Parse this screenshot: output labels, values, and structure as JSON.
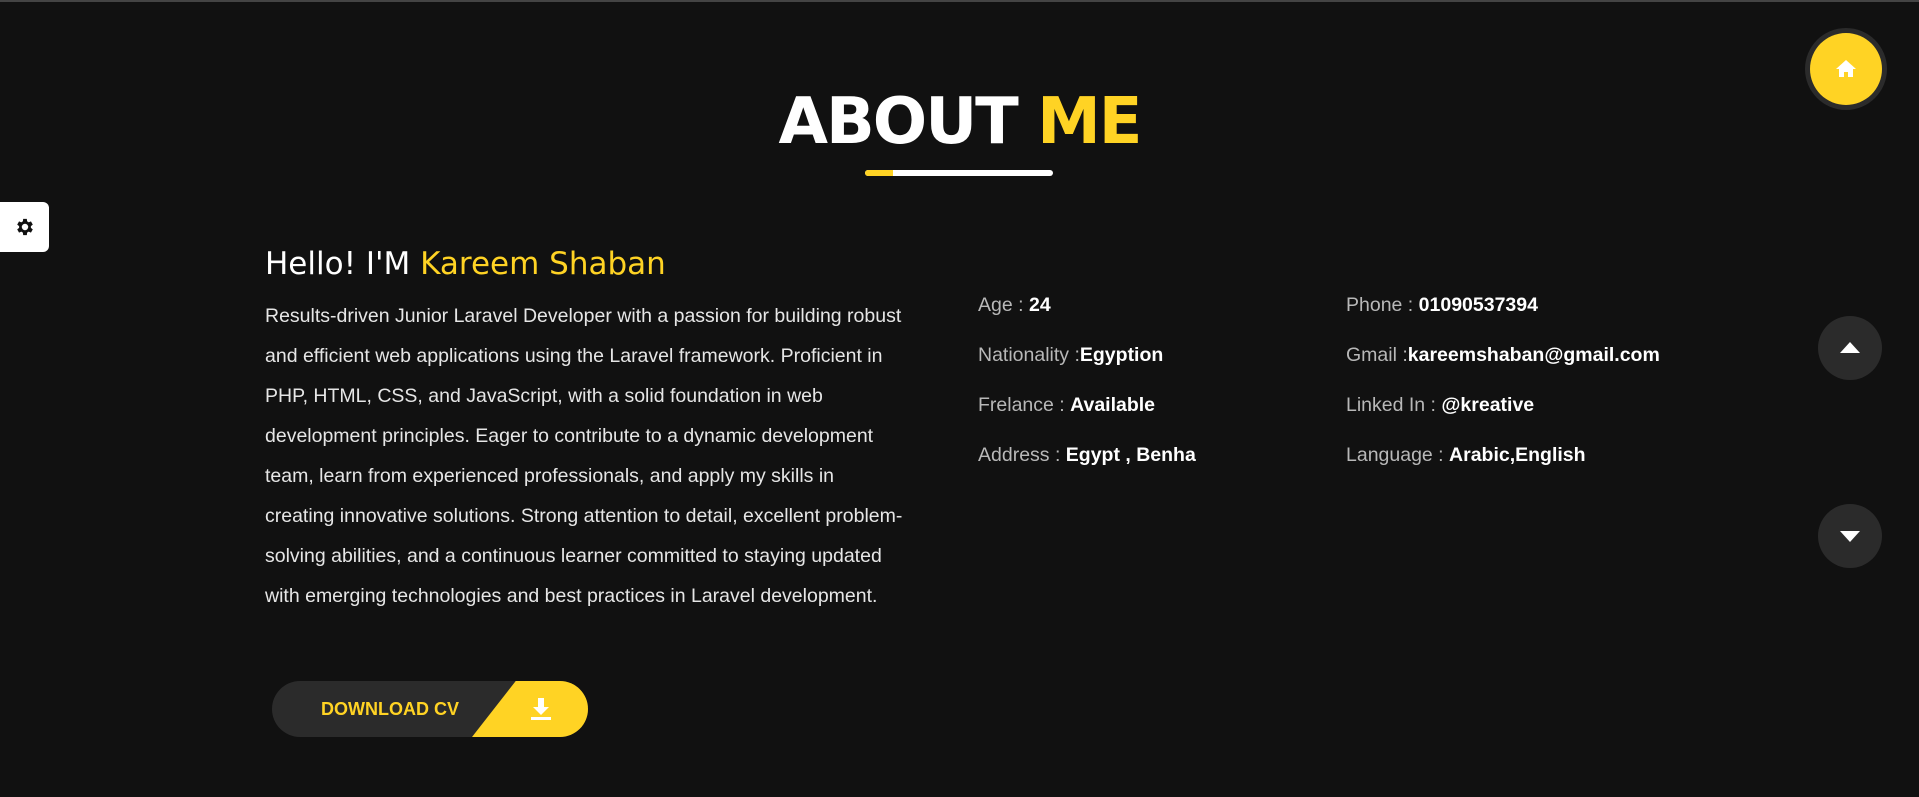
{
  "header": {
    "title_white": "ABOUT",
    "title_yellow": "ME"
  },
  "intro": {
    "greeting": "Hello! I'M",
    "name": "Kareem Shaban",
    "bio": "Results-driven Junior Laravel Developer with a passion for building robust and efficient web applications using the Laravel framework. Proficient in PHP, HTML, CSS, and JavaScript, with a solid foundation in web development principles. Eager to contribute to a dynamic development team, learn from experienced professionals, and apply my skills in creating innovative solutions. Strong attention to detail, excellent problem-solving abilities, and a continuous learner committed to staying updated with emerging technologies and best practices in Laravel development."
  },
  "download": {
    "label": "DOWNLOAD CV",
    "icon": "download-icon"
  },
  "info": {
    "age": {
      "label": "Age :",
      "value": "24"
    },
    "nationality": {
      "label": "Nationality :",
      "value": "Egyption"
    },
    "freelance": {
      "label": "Frelance :",
      "value": "Available"
    },
    "address": {
      "label": "Address :",
      "value": "Egypt , Benha"
    },
    "phone": {
      "label": "Phone :",
      "value": "01090537394"
    },
    "gmail": {
      "label": "Gmail :",
      "value": "kareemshaban@gmail.com"
    },
    "linkedin": {
      "label": "Linked In :",
      "value": "@kreative"
    },
    "language": {
      "label": "Language :",
      "value": "Arabic,English"
    }
  },
  "icons": {
    "settings": "gear-icon",
    "home": "home-icon",
    "up": "caret-up-icon",
    "down": "caret-down-icon"
  },
  "colors": {
    "accent": "#ffd324",
    "background": "#111111",
    "button_bg": "#2b2b2b"
  }
}
